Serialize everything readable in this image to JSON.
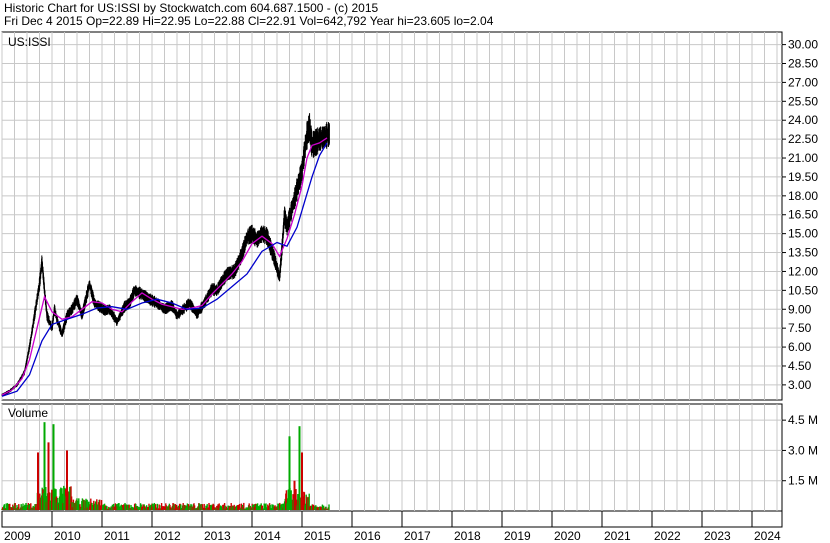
{
  "header": {
    "line1": "Historic Chart for US:ISSI by Stockwatch.com 604.687.1500 - (c) 2015",
    "line2": "Fri Dec  4 2015   Op=22.89   Hi=22.95   Lo=22.88   Cl=22.91   Vol=642,792   Year hi=23.605   lo=2.04"
  },
  "chart_data": [
    {
      "type": "line",
      "title": "US:ISSI",
      "ylim": [
        1.8,
        31.0
      ],
      "y_ticks": [
        "30.00",
        "28.50",
        "27.00",
        "25.50",
        "24.00",
        "22.50",
        "21.00",
        "19.50",
        "18.00",
        "16.50",
        "15.00",
        "13.50",
        "12.00",
        "10.50",
        "9.00",
        "7.50",
        "6.00",
        "4.50",
        "3.00"
      ],
      "x_ticks": [
        "2009",
        "2010",
        "2011",
        "2012",
        "2013",
        "2014",
        "2015",
        "2016",
        "2017",
        "2018",
        "2019",
        "2020",
        "2021",
        "2022",
        "2023",
        "2024"
      ],
      "xlim": [
        2009.0,
        2024.6
      ],
      "grid": true,
      "series": [
        {
          "color": "#000000",
          "x": [
            2009.0,
            2009.15,
            2009.3,
            2009.45,
            2009.55,
            2009.65,
            2009.75,
            2009.8,
            2009.85,
            2009.9,
            2010.0,
            2010.05,
            2010.1,
            2010.2,
            2010.3,
            2010.4,
            2010.5,
            2010.6,
            2010.75,
            2010.85,
            2010.95,
            2011.05,
            2011.15,
            2011.3,
            2011.45,
            2011.55,
            2011.65,
            2011.8,
            2011.95,
            2012.1,
            2012.25,
            2012.4,
            2012.5,
            2012.6,
            2012.75,
            2012.9,
            2013.05,
            2013.2,
            2013.3,
            2013.4,
            2013.5,
            2013.65,
            2013.8,
            2013.9,
            2014.0,
            2014.1,
            2014.2,
            2014.3,
            2014.45,
            2014.55,
            2014.6,
            2014.65,
            2014.7,
            2014.8,
            2014.9,
            2015.0,
            2015.05,
            2015.1,
            2015.15,
            2015.2,
            2015.3,
            2015.35,
            2015.45,
            2015.55
          ],
          "values": [
            2.2,
            2.5,
            3.0,
            4.0,
            6.0,
            8.5,
            11.0,
            12.8,
            10.5,
            8.5,
            7.5,
            9.0,
            8.2,
            7.0,
            8.5,
            9.0,
            9.8,
            8.5,
            11.0,
            9.5,
            9.2,
            8.9,
            9.0,
            8.0,
            9.2,
            9.5,
            10.5,
            10.2,
            9.8,
            9.5,
            9.0,
            9.3,
            8.5,
            8.9,
            9.5,
            8.6,
            9.5,
            10.6,
            10.5,
            11.2,
            11.8,
            12.0,
            13.4,
            14.7,
            15.0,
            14.5,
            15.0,
            14.8,
            13.0,
            11.5,
            13.8,
            16.5,
            15.5,
            17.0,
            18.5,
            20.0,
            21.5,
            22.8,
            23.5,
            22.0,
            22.3,
            22.5,
            22.7,
            22.91
          ]
        },
        {
          "color": "#cc00cc",
          "x": [
            2009.0,
            2009.2,
            2009.4,
            2009.55,
            2009.7,
            2009.85,
            2010.0,
            2010.2,
            2010.4,
            2010.6,
            2010.8,
            2011.0,
            2011.2,
            2011.4,
            2011.6,
            2011.8,
            2012.0,
            2012.2,
            2012.4,
            2012.6,
            2012.8,
            2013.0,
            2013.2,
            2013.4,
            2013.6,
            2013.8,
            2014.0,
            2014.2,
            2014.4,
            2014.55,
            2014.7,
            2014.85,
            2015.0,
            2015.1,
            2015.2,
            2015.35,
            2015.5
          ],
          "values": [
            2.2,
            2.6,
            3.5,
            5.0,
            7.5,
            10.0,
            8.8,
            8.2,
            8.4,
            9.0,
            9.6,
            9.5,
            9.0,
            8.8,
            9.6,
            10.3,
            9.8,
            9.4,
            9.2,
            9.0,
            9.1,
            9.3,
            10.2,
            11.0,
            11.8,
            12.8,
            14.2,
            14.8,
            14.2,
            13.2,
            14.6,
            16.5,
            18.8,
            21.0,
            22.0,
            22.2,
            22.6
          ]
        },
        {
          "color": "#0000cc",
          "x": [
            2009.0,
            2009.3,
            2009.55,
            2009.8,
            2010.0,
            2010.3,
            2010.6,
            2010.9,
            2011.2,
            2011.5,
            2011.8,
            2012.1,
            2012.4,
            2012.7,
            2013.0,
            2013.3,
            2013.6,
            2013.9,
            2014.2,
            2014.5,
            2014.7,
            2014.9,
            2015.05,
            2015.2,
            2015.35,
            2015.5
          ],
          "values": [
            2.1,
            2.5,
            3.8,
            6.5,
            7.8,
            8.2,
            8.6,
            9.1,
            9.2,
            9.0,
            9.5,
            9.8,
            9.5,
            9.0,
            9.1,
            9.8,
            10.8,
            11.8,
            13.6,
            14.3,
            14.0,
            15.5,
            17.5,
            19.5,
            21.2,
            22.2
          ]
        }
      ]
    },
    {
      "type": "bar",
      "title": "Volume",
      "ylim": [
        0,
        5.3
      ],
      "y_ticks": [
        "4.5 M",
        "3.0 M",
        "1.5 M"
      ],
      "spikes": [
        {
          "x": 2009.85,
          "value": 4.4,
          "color": "#00aa00"
        },
        {
          "x": 2009.93,
          "value": 3.4,
          "color": "#cc0000"
        },
        {
          "x": 2010.03,
          "value": 4.3,
          "color": "#00aa00"
        },
        {
          "x": 2009.72,
          "value": 2.9,
          "color": "#cc0000"
        },
        {
          "x": 2010.3,
          "value": 3.0,
          "color": "#cc0000"
        },
        {
          "x": 2014.75,
          "value": 3.7,
          "color": "#00aa00"
        },
        {
          "x": 2014.95,
          "value": 4.2,
          "color": "#00aa00"
        },
        {
          "x": 2015.0,
          "value": 2.9,
          "color": "#cc0000"
        },
        {
          "x": 2014.85,
          "value": 1.5,
          "color": "#cc0000"
        }
      ]
    }
  ],
  "colors": {
    "price": "#000000",
    "ma_short": "#cc00cc",
    "ma_long": "#0000cc",
    "vol_up": "#00aa00",
    "vol_down": "#cc0000",
    "grid": "#c8c8c8"
  }
}
